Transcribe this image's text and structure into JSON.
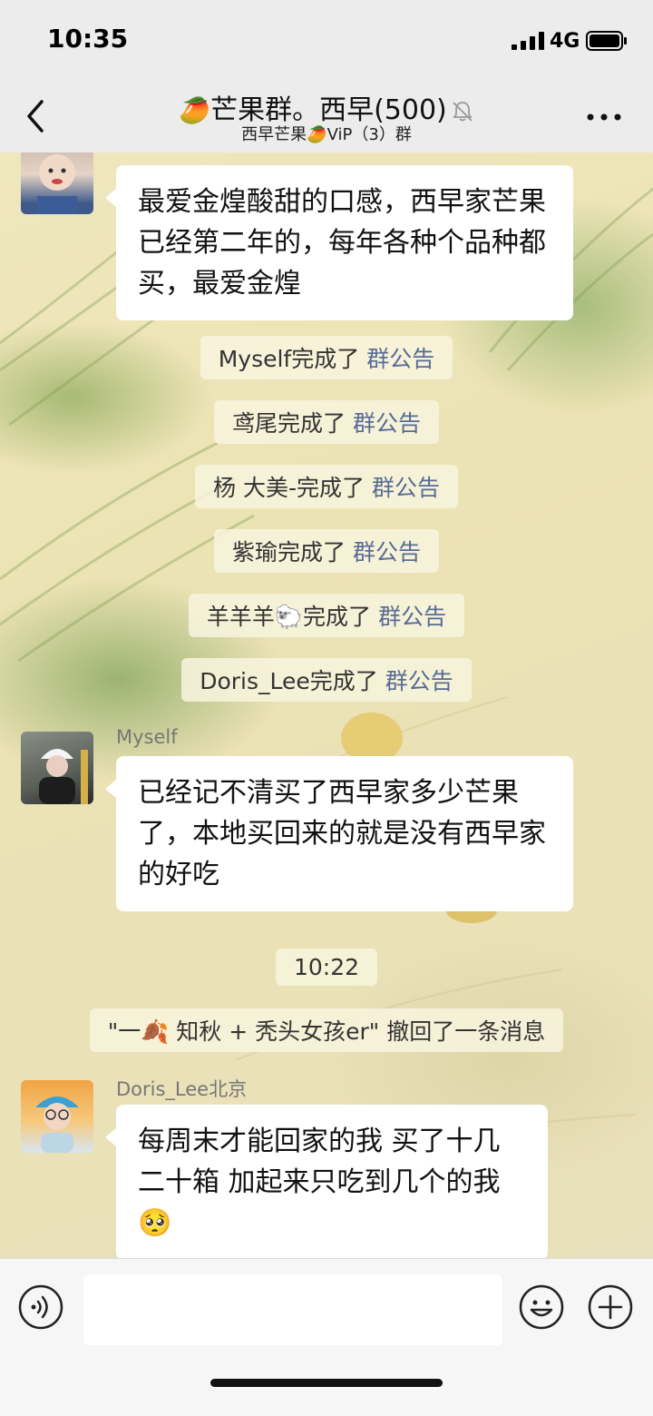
{
  "status_bar": {
    "time": "10:35",
    "network": "4G"
  },
  "header": {
    "title_emoji": "🥭",
    "title": "芒果群。西早(500)",
    "subtitle_left": "西早芒果",
    "subtitle_emoji": "🥭",
    "subtitle_right": "ViP（3）群"
  },
  "messages": {
    "m1": {
      "text": "最爱金煌酸甜的口感，西早家芒果已经第二年的，每年各种个品种都买，最爱金煌"
    },
    "notices": [
      {
        "name": "Myself完成了",
        "link": "群公告"
      },
      {
        "name": "鸢尾完成了",
        "link": "群公告"
      },
      {
        "name": "杨 大美-完成了",
        "link": "群公告"
      },
      {
        "name": "紫瑜完成了",
        "link": "群公告"
      },
      {
        "name": "羊羊羊🐑完成了",
        "link": "群公告"
      },
      {
        "name": "Doris_Lee完成了",
        "link": "群公告"
      }
    ],
    "m2": {
      "sender": "Myself",
      "text": "已经记不清买了西早家多少芒果了，本地买回来的就是没有西早家的好吃"
    },
    "timestamp": "10:22",
    "recall": "\"一🍂 知秋 + 秃头女孩er\" 撤回了一条消息",
    "m3": {
      "sender": "Doris_Lee北京",
      "text": "每周末才能回家的我 买了十几二十箱 加起来只吃到几个的我🥺"
    }
  },
  "input": {
    "placeholder": ""
  },
  "colors": {
    "link": "#576b95",
    "bubble": "#ffffff",
    "chat_bg": "#ece3b4"
  }
}
